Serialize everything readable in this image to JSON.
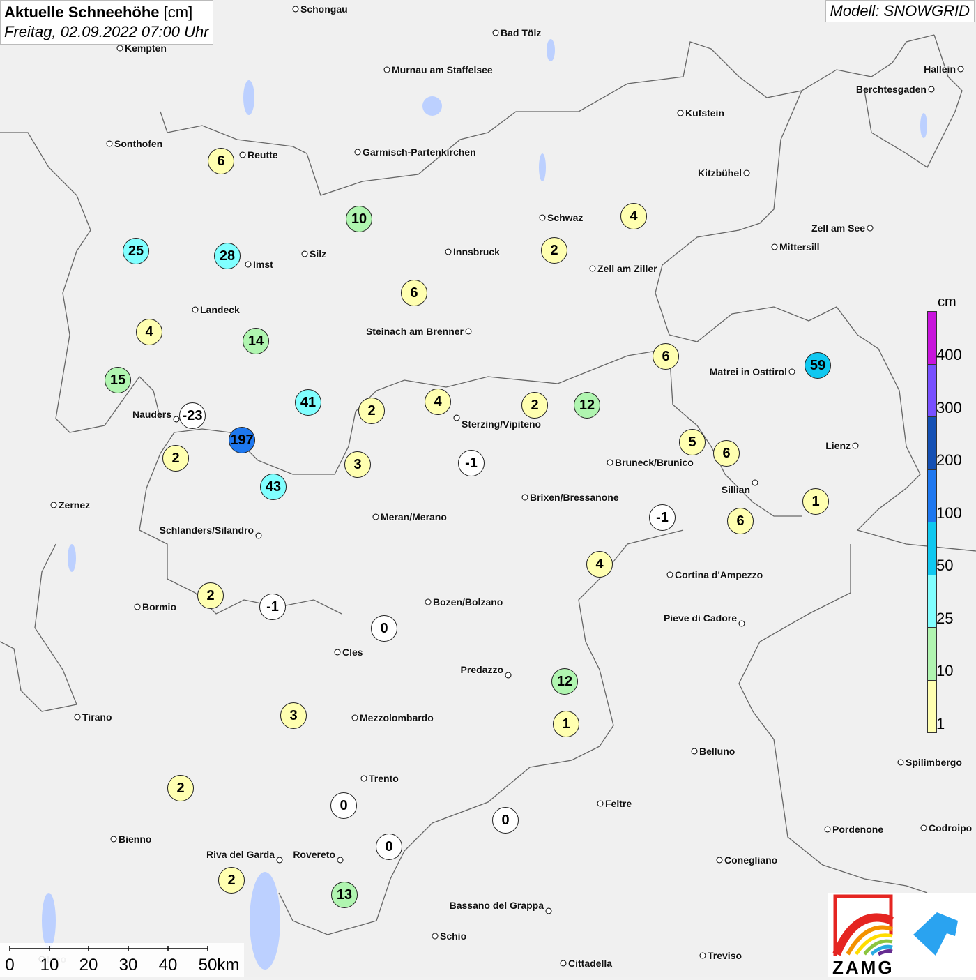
{
  "header": {
    "title_bold": "Aktuelle Schneehöhe",
    "title_unit": "[cm]",
    "subtitle": "Freitag, 02.09.2022 07:00 Uhr",
    "model": "Modell: SNOWGRID"
  },
  "legend": {
    "unit": "cm",
    "labels": [
      "400",
      "300",
      "200",
      "100",
      "50",
      "25",
      "10",
      "1"
    ],
    "colors": [
      "#c814dc",
      "#7850ff",
      "#1450b4",
      "#1e78f0",
      "#10c8f0",
      "#80ffff",
      "#b0f5b0",
      "#ffffb0"
    ]
  },
  "colors": {
    "below_1": "#ffffff",
    "1_10": "#ffffb0",
    "10_25": "#b0f5b0",
    "25_50": "#80ffff",
    "50_100": "#10c8f0",
    "100_200": "#1e78f0"
  },
  "cities": [
    "Schongau",
    "Bad Tölz",
    "Kempten",
    "Murnau am Staffelsee",
    "Hallein",
    "Berchtesgaden",
    "Kufstein",
    "Sonthofen",
    "Reutte",
    "Garmisch-Partenkirchen",
    "Kitzbühel",
    "Schwaz",
    "Zell am See",
    "Mittersill",
    "Innsbruck",
    "Silz",
    "Imst",
    "Zell am Ziller",
    "Landeck",
    "Steinach am Brenner",
    "Matrei in Osttirol",
    "Nauders",
    "Sterzing/Vipiteno",
    "Lienz",
    "Bruneck/Brunico",
    "Sillian",
    "Brixen/Bressanone",
    "Zernez",
    "Meran/Merano",
    "Schlanders/Silandro",
    "Cortina d'Ampezzo",
    "Bozen/Bolzano",
    "Bormio",
    "Pieve di Cadore",
    "Cles",
    "Predazzo",
    "Tirano",
    "Mezzolombardo",
    "Belluno",
    "Spilimbergo",
    "Trento",
    "Feltre",
    "Pordenone",
    "Codroipo",
    "Bienno",
    "Riva del Garda",
    "Rovereto",
    "Conegliano",
    "Bassano del Grappa",
    "Schio",
    "Treviso",
    "Cittadella",
    "Iseo"
  ],
  "stations": [
    6,
    10,
    4,
    25,
    28,
    2,
    6,
    4,
    14,
    6,
    59,
    15,
    41,
    2,
    4,
    2,
    12,
    -23,
    197,
    2,
    5,
    6,
    3,
    -1,
    43,
    1,
    -1,
    6,
    4,
    2,
    -1,
    0,
    12,
    1,
    3,
    2,
    0,
    0,
    0,
    2,
    13
  ],
  "scale": {
    "ticks": [
      "0",
      "10",
      "20",
      "30",
      "40",
      "50km"
    ]
  },
  "logo": {
    "text": "ZAMG"
  }
}
